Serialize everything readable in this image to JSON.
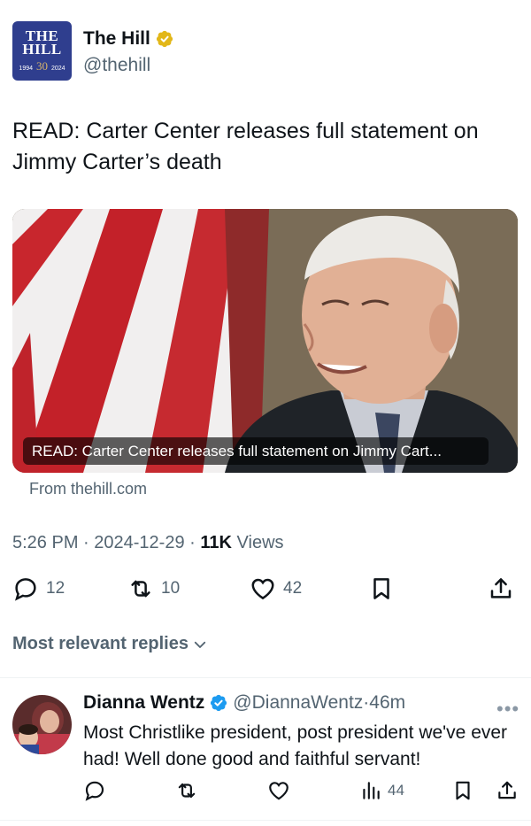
{
  "account": {
    "logo_line1": "THE",
    "logo_line2": "HILL",
    "logo_year_start": "1994",
    "logo_anniversary": "30",
    "logo_year_end": "2024",
    "name": "The Hill",
    "handle": "@thehill",
    "verified_badge": "gold-verified-icon"
  },
  "tweet": {
    "text": "READ: Carter Center releases full statement on Jimmy Carter’s death",
    "card_caption": "READ: Carter Center releases full statement on Jimmy Cart...",
    "card_source": "From thehill.com",
    "time": "5:26 PM",
    "sep1": "·",
    "date": "2024-12-29",
    "sep2": "·",
    "views_count": "11K",
    "views_label": "Views"
  },
  "actions": {
    "replies": "12",
    "reposts": "10",
    "likes": "42"
  },
  "replies_sort": {
    "label": "Most relevant replies"
  },
  "reply": {
    "name": "Dianna Wentz",
    "handle": "@DiannaWentz",
    "sep": "·",
    "time": "46m",
    "text": "Most Christlike president, post president we've ever had! Well done good and faithful servant!",
    "more_glyph": "•••",
    "views": "44"
  },
  "colors": {
    "primary_text": "#0f1419",
    "secondary_text": "#536471",
    "verified_blue": "#1d9bf0",
    "verified_gold": "#e2b719",
    "logo_bg": "#2f3e8e"
  }
}
